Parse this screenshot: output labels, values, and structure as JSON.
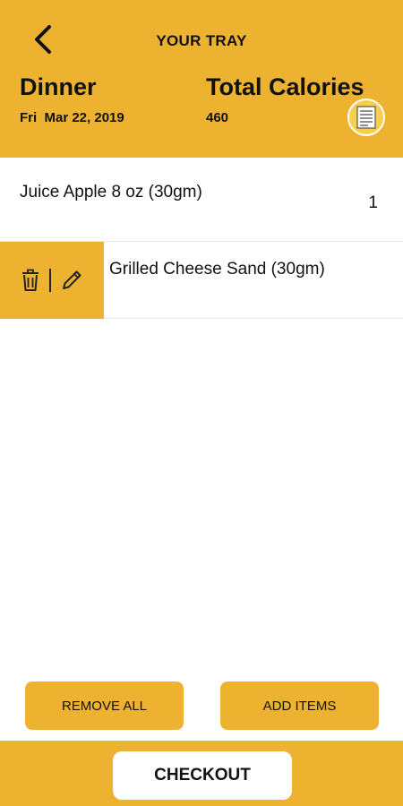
{
  "header": {
    "title": "YOUR TRAY",
    "meal": "Dinner",
    "date": "Fri  Mar 22, 2019",
    "calories_label": "Total Calories",
    "calories_value": "460"
  },
  "tray_items": [
    {
      "name": "Juice Apple 8 oz (30gm)",
      "quantity": "1"
    },
    {
      "name": "Grilled Cheese Sand (30gm)"
    }
  ],
  "actions": {
    "remove_all": "REMOVE ALL",
    "add_items": "ADD ITEMS",
    "checkout": "CHECKOUT"
  },
  "icons": [
    "back-arrow-icon",
    "document-icon",
    "trash-icon",
    "pencil-icon"
  ],
  "colors": {
    "accent": "#EDB22F",
    "background": "#FFFFFF"
  }
}
